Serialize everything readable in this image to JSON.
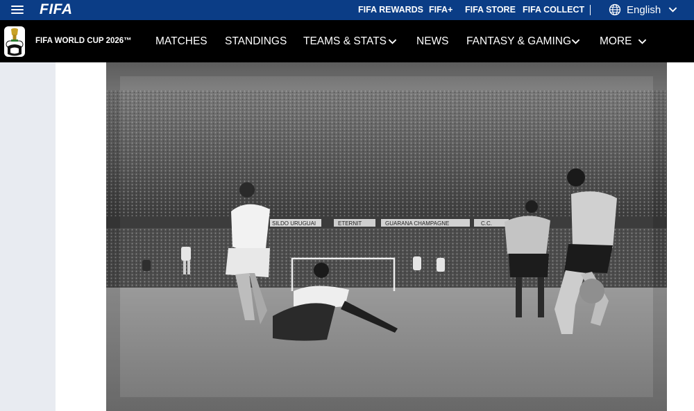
{
  "header": {
    "brand": "FIFA",
    "links": [
      {
        "label": "FIFA REWARDS"
      },
      {
        "label": "FIFA+"
      },
      {
        "label": "FIFA STORE"
      },
      {
        "label": "FIFA COLLECT"
      }
    ],
    "language": "English"
  },
  "nav": {
    "title": "FIFA WORLD CUP 2026™",
    "items": [
      {
        "label": "MATCHES"
      },
      {
        "label": "STANDINGS"
      },
      {
        "label": "TEAMS & STATS"
      },
      {
        "label": "NEWS"
      },
      {
        "label": "FANTASY & GAMING"
      },
      {
        "label": "MORE"
      }
    ]
  },
  "hero": {
    "banners": [
      "SILDO URUGUAI",
      "ETERNIT",
      "GUARANA CHAMPAGNE",
      "C.C."
    ]
  },
  "colors": {
    "topbar": "#0b3d86",
    "navbar": "#000000",
    "rail": "#e8ebf1"
  },
  "icons": {
    "menu": "hamburger-icon",
    "language": "globe-icon",
    "dropdown": "chevron-down-icon",
    "tournament": "world-cup-trophy-logo"
  }
}
